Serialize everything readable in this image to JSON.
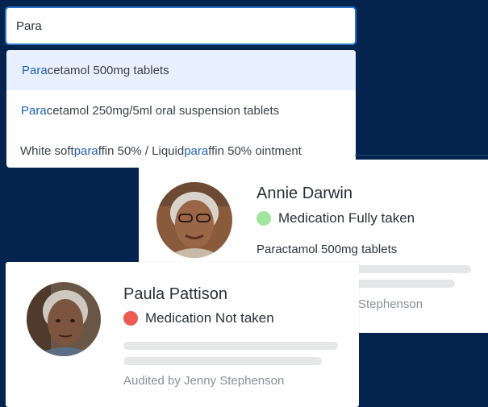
{
  "search": {
    "value": "Para"
  },
  "dropdown": {
    "options": [
      {
        "match": "Para",
        "rest": "cetamol 500mg tablets"
      },
      {
        "match": "Para",
        "rest": "cetamol 250mg/5ml oral suspension tablets"
      },
      {
        "pre": "White soft ",
        "match1": "para",
        "mid": "ffin 50% / Liquid ",
        "match2": "para",
        "post": "ffin 50% ointment"
      }
    ]
  },
  "cards": {
    "annie": {
      "name": "Annie Darwin",
      "status": "Medication Fully taken",
      "status_color": "#a3e49f",
      "medication": "Paractamol 500mg tablets",
      "audit": "Stephenson"
    },
    "paula": {
      "name": "Paula Pattison",
      "status": "Medication Not taken",
      "status_color": "#ee5a52",
      "audit": "Audited by Jenny Stephenson"
    }
  },
  "colors": {
    "background": "#04234f",
    "accent": "#1f63b8",
    "focus_border": "#2a73c8"
  },
  "icons": {
    "annie_avatar": "avatar-photo",
    "paula_avatar": "avatar-photo"
  }
}
